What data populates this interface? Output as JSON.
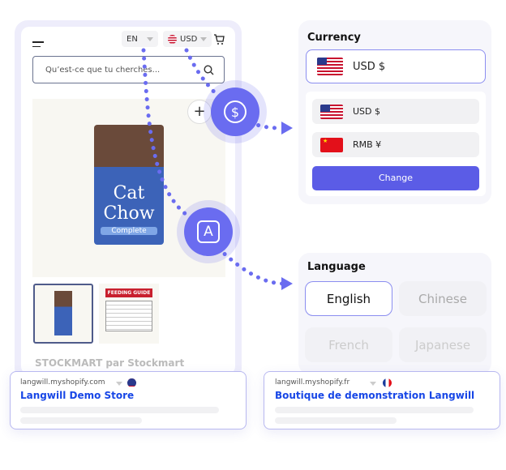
{
  "store": {
    "lang_selector": "EN",
    "currency_selector": "USD",
    "search_placeholder": "Qu’est-ce que tu cherches...",
    "product_brand": "Cat Chow",
    "product_name": "Complete",
    "thumb_label": "FEEDING GUIDE",
    "vendor": "STOCKMART par Stockmart"
  },
  "currency": {
    "title": "Currency",
    "selected": "USD $",
    "options": [
      {
        "label": "USD $",
        "flag": "us-flag"
      },
      {
        "label": "RMB ¥",
        "flag": "cn-flag"
      }
    ],
    "button": "Change"
  },
  "language": {
    "title": "Language",
    "options": [
      "English",
      "Chinese",
      "French",
      "Japanese"
    ],
    "selected": "English"
  },
  "results": [
    {
      "domain": "langwill.myshopify.com",
      "title": "Langwill Demo Store",
      "flag": "us-flag"
    },
    {
      "domain": "langwill.myshopify.fr",
      "title": "Boutique de demonstration Langwill",
      "flag": "fr-flag"
    }
  ],
  "icons": {
    "currency": "$",
    "language": "A"
  },
  "colors": {
    "accent": "#6a6cf0",
    "link": "#1746e6",
    "button": "#5b5ce6"
  }
}
